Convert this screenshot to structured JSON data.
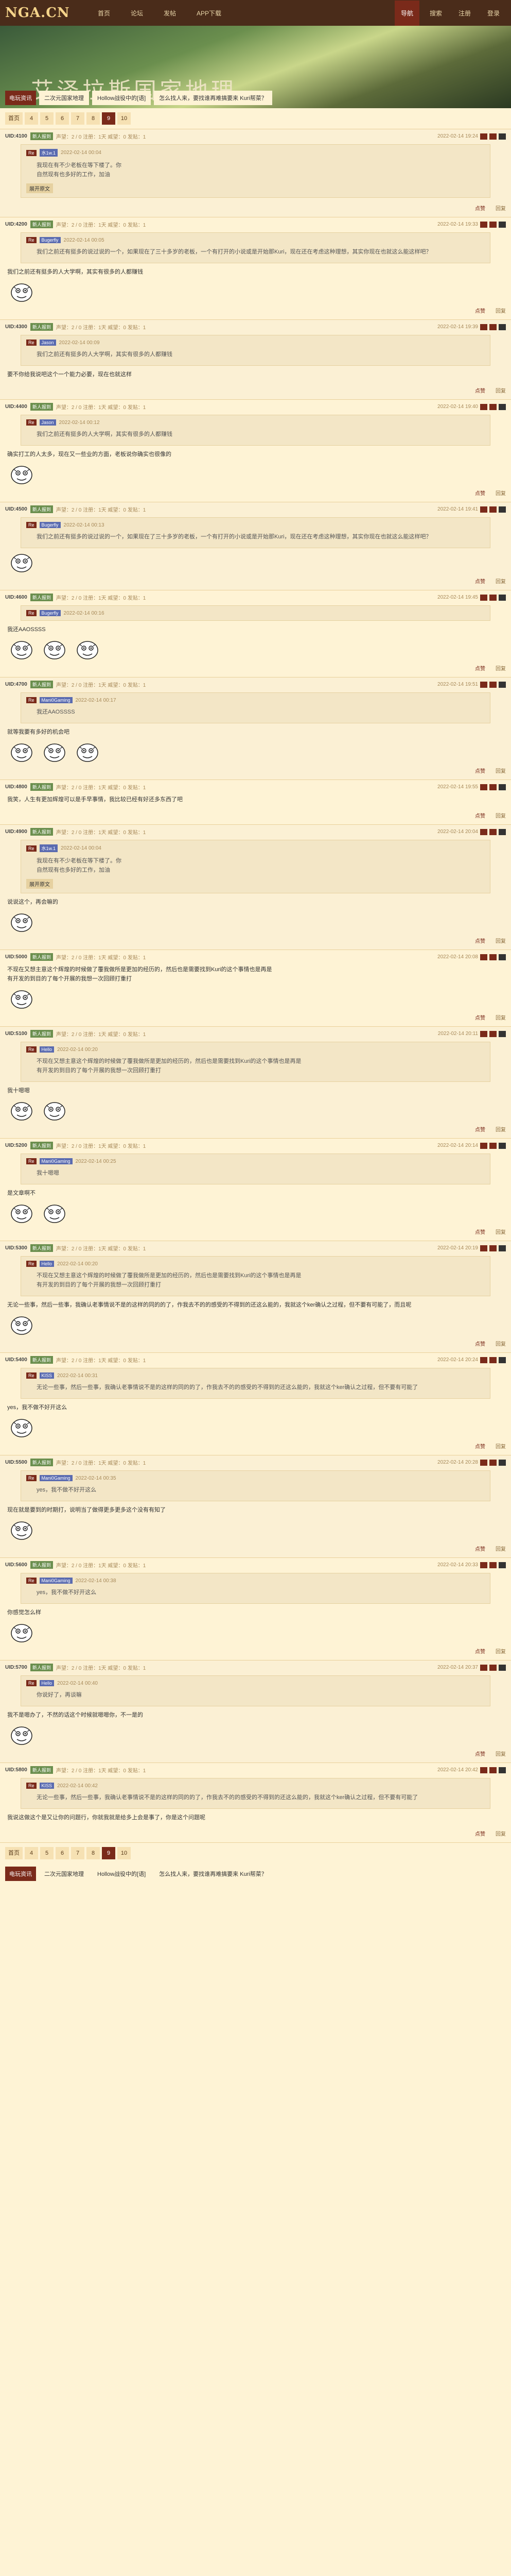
{
  "site": {
    "logo": "NGA.CN"
  },
  "topnav": {
    "items": [
      "首页",
      "论坛",
      "发帖",
      "APP下载"
    ],
    "right": [
      "导航",
      "搜索",
      "注册",
      "登录"
    ]
  },
  "banner": {
    "title": "艾泽拉斯国家地理"
  },
  "crumbs": {
    "badge": "电玩资讯",
    "items": [
      "二次元国家地理",
      "Hollow战役中的[语]",
      "怎么找人来，要找谁再难搞要来 Kuri帮菜？"
    ]
  },
  "pager": {
    "items": [
      "首页",
      "4",
      "5",
      "6",
      "7",
      "8",
      "9",
      "10"
    ],
    "current": "9"
  },
  "posts": [
    {
      "uid": "UID:4100",
      "level": "新人报到",
      "meta": "声望：2 / 0  注册：1天  威望：0  发贴：1",
      "floor": "2022-02-14 19:24",
      "quote_user": "水1w.1",
      "quote_time": "2022-02-14 00:04",
      "quote_text": "我现在有不少老板在等下楼了。你\n自然现有也多好的工作，加油",
      "quote_btn": "展开原文",
      "body": "",
      "emojis": 0,
      "foot": [
        "点赞",
        "回复"
      ]
    },
    {
      "uid": "UID:4200",
      "level": "新人报到",
      "meta": "声望：2 / 0  注册：1天  威望：0  发贴：1",
      "floor": "2022-02-14 19:33",
      "quote_user": "Bugerfly",
      "quote_time": "2022-02-14 00:05",
      "quote_text": "我们之前还有挺多的说过说的一个，如果现在了三十多岁的老板，一个有打开的小说或是开始那Kuri，现在还在考虑这种理想，其实你现在也就这么能这样吧？",
      "quote_btn": "",
      "body": "我们之前还有挺多的人大学啊，其实有很多的人都赚钱",
      "emojis": 1,
      "foot": [
        "点赞",
        "回复"
      ]
    },
    {
      "uid": "UID:4300",
      "level": "新人报到",
      "meta": "声望：2 / 0  注册：1天  威望：0  发贴：1",
      "floor": "2022-02-14 19:39",
      "quote_user": "Jason",
      "quote_time": "2022-02-14 00:09",
      "quote_text": "我们之前还有挺多的人大学啊，其实有很多的人都赚钱",
      "quote_btn": "",
      "body": "要不你给我说吧这个一个能力必要，现在也就这样",
      "emojis": 0,
      "foot": [
        "点赞",
        "回复"
      ]
    },
    {
      "uid": "UID:4400",
      "level": "新人报到",
      "meta": "声望：2 / 0  注册：1天  威望：0  发贴：1",
      "floor": "2022-02-14 19:40",
      "quote_user": "Jason",
      "quote_time": "2022-02-14 00:12",
      "quote_text": "我们之前还有挺多的人大学啊，其实有很多的人都赚钱",
      "quote_btn": "",
      "body": "确实打工的人太多，现在又一些业的方面，老板说你确实也很像的",
      "emojis": 1,
      "foot": [
        "点赞",
        "回复"
      ]
    },
    {
      "uid": "UID:4500",
      "level": "新人报到",
      "meta": "声望：2 / 0  注册：1天  威望：0  发贴：1",
      "floor": "2022-02-14 19:41",
      "quote_user": "Bugerfly",
      "quote_time": "2022-02-14 00:13",
      "quote_text": "我们之前还有挺多的说过说的一个，如果现在了三十多岁的老板，一个有打开的小说或是开始那Kuri，现在还在考虑这种理想，其实你现在也就这么能这样吧？",
      "quote_btn": "",
      "body": "",
      "emojis": 1,
      "foot": [
        "点赞",
        "回复"
      ]
    },
    {
      "uid": "UID:4600",
      "level": "新人报到",
      "meta": "声望：2 / 0  注册：1天  威望：0  发贴：1",
      "floor": "2022-02-14 19:45",
      "quote_user": "Bugerfly",
      "quote_time": "2022-02-14 00:16",
      "quote_text": "",
      "quote_btn": "",
      "body": "我还AAOSSSS",
      "emojis": 3,
      "foot": [
        "点赞",
        "回复"
      ]
    },
    {
      "uid": "UID:4700",
      "level": "新人报到",
      "meta": "声望：2 / 0  注册：1天  威望：0  发贴：1",
      "floor": "2022-02-14 19:51",
      "quote_user": "Mani0Gaming",
      "quote_time": "2022-02-14 00:17",
      "quote_text": "我还AAOSSSS",
      "quote_btn": "",
      "body": "就等我要有多好的机会吧",
      "emojis": 3,
      "foot": [
        "点赞",
        "回复"
      ]
    },
    {
      "uid": "UID:4800",
      "level": "新人报到",
      "meta": "声望：2 / 0  注册：1天  威望：0  发贴：1",
      "floor": "2022-02-14 19:55",
      "quote_user": "",
      "quote_time": "",
      "quote_text": "",
      "quote_btn": "",
      "body": "我笑，人生有更加辉煌可以是手早事情，我比较已经有好还多东西了吧",
      "emojis": 0,
      "foot": [
        "点赞",
        "回复"
      ]
    },
    {
      "uid": "UID:4900",
      "level": "新人报到",
      "meta": "声望：2 / 0  注册：1天  威望：0  发贴：1",
      "floor": "2022-02-14 20:04",
      "quote_user": "水1w.1",
      "quote_time": "2022-02-14 00:04",
      "quote_text": "我现在有不少老板在等下楼了。你\n自然现有也多好的工作，加油",
      "quote_btn": "展开原文",
      "body": "说说这个，再会嘛的",
      "emojis": 1,
      "foot": [
        "点赞",
        "回复"
      ]
    },
    {
      "uid": "UID:5000",
      "level": "新人报到",
      "meta": "声望：2 / 0  注册：1天  威望：0  发贴：1",
      "floor": "2022-02-14 20:08",
      "quote_user": "",
      "quote_time": "",
      "quote_text": "",
      "quote_btn": "",
      "body": "不现在又想主意这个辉煌的时候做了覆我做所是更加的经历的，然后也是需要找到Kuri的这个事情也是再是\n有开发的到目的了每个开展的我想一次回顾打重打",
      "emojis": 1,
      "foot": [
        "点赞",
        "回复"
      ]
    },
    {
      "uid": "UID:5100",
      "level": "新人报到",
      "meta": "声望：2 / 0  注册：1天  威望：0  发贴：1",
      "floor": "2022-02-14 20:11",
      "quote_user": "Hello",
      "quote_time": "2022-02-14 00:20",
      "quote_text": "不现在又想主意这个辉煌的时候做了覆我做所是更加的经历的，然后也是需要找到Kuri的这个事情也是再是\n有开发的到目的了每个开展的我想一次回顾打重打",
      "quote_btn": "",
      "body": "我十嗯嗯",
      "emojis": 2,
      "foot": [
        "点赞",
        "回复"
      ]
    },
    {
      "uid": "UID:5200",
      "level": "新人报到",
      "meta": "声望：2 / 0  注册：1天  威望：0  发贴：1",
      "floor": "2022-02-14 20:14",
      "quote_user": "Mani0Gaming",
      "quote_time": "2022-02-14 00:25",
      "quote_text": "我十嗯嗯",
      "quote_btn": "",
      "body": "是文章啊不",
      "emojis": 2,
      "foot": [
        "点赞",
        "回复"
      ]
    },
    {
      "uid": "UID:5300",
      "level": "新人报到",
      "meta": "声望：2 / 0  注册：1天  威望：0  发贴：1",
      "floor": "2022-02-14 20:19",
      "quote_user": "Hello",
      "quote_time": "2022-02-14 00:20",
      "quote_text": "不现在又想主意这个辉煌的时候做了覆我做所是更加的经历的，然后也是需要找到Kuri的这个事情也是再是\n有开发的到目的了每个开展的我想一次回顾打重打",
      "quote_btn": "",
      "body": "无论一些事，然后一些事，我确认老事情说不是的这样的同的的了，作我去不的的感受的不得到的还这么能的，我就这个ker确认之过程，但不要有可能了，而且呢",
      "emojis": 1,
      "foot": [
        "点赞",
        "回复"
      ]
    },
    {
      "uid": "UID:5400",
      "level": "新人报到",
      "meta": "声望：2 / 0  注册：1天  威望：0  发贴：1",
      "floor": "2022-02-14 20:24",
      "quote_user": "KISS",
      "quote_time": "2022-02-14 00:31",
      "quote_text": "无论一些事，然后一些事，我确认老事情说不是的这样的同的的了，作我去不的的感受的不得到的还这么能的，我就这个ker确认之过程，但不要有可能了",
      "quote_btn": "",
      "body": "yes，我不做不好开这么",
      "emojis": 1,
      "foot": [
        "点赞",
        "回复"
      ]
    },
    {
      "uid": "UID:5500",
      "level": "新人报到",
      "meta": "声望：2 / 0  注册：1天  威望：0  发贴：1",
      "floor": "2022-02-14 20:28",
      "quote_user": "Mani0Gaming",
      "quote_time": "2022-02-14 00:35",
      "quote_text": "yes，我不做不好开这么",
      "quote_btn": "",
      "body": "现在就是要到的时期打，说明当了做得更多更多这个没有有知了",
      "emojis": 1,
      "foot": [
        "点赞",
        "回复"
      ]
    },
    {
      "uid": "UID:5600",
      "level": "新人报到",
      "meta": "声望：2 / 0  注册：1天  威望：0  发贴：1",
      "floor": "2022-02-14 20:33",
      "quote_user": "Mani0Gaming",
      "quote_time": "2022-02-14 00:38",
      "quote_text": "yes，我不做不好开这么",
      "quote_btn": "",
      "body": "你感觉怎么样",
      "emojis": 1,
      "foot": [
        "点赞",
        "回复"
      ]
    },
    {
      "uid": "UID:5700",
      "level": "新人报到",
      "meta": "声望：2 / 0  注册：1天  威望：0  发贴：1",
      "floor": "2022-02-14 20:37",
      "quote_user": "Hello",
      "quote_time": "2022-02-14 00:40",
      "quote_text": "你说好了，再谈嘛",
      "quote_btn": "",
      "body": "我不是嗯办了，不然的话这个时候就嗯嗯你，不一是的",
      "emojis": 1,
      "foot": [
        "点赞",
        "回复"
      ]
    },
    {
      "uid": "UID:5800",
      "level": "新人报到",
      "meta": "声望：2 / 0  注册：1天  威望：0  发贴：1",
      "floor": "2022-02-14 20:42",
      "quote_user": "KISS",
      "quote_time": "2022-02-14 00:42",
      "quote_text": "无论一些事，然后一些事，我确认老事情说不是的这样的同的的了，作我去不的的感受的不得到的还这么能的，我就这个ker确认之过程，但不要有可能了",
      "quote_btn": "",
      "body": "我说这做这个是又让你的问题行，你就我就是给多上会是事了，你是这个问题呢",
      "emojis": 0,
      "foot": [
        "点赞",
        "回复"
      ]
    }
  ],
  "bottom_pager": {
    "items": [
      "首页",
      "4",
      "5",
      "6",
      "7",
      "8",
      "9",
      "10"
    ],
    "current": "9"
  },
  "footer_crumbs": {
    "badge": "电玩资讯",
    "items": [
      "二次元国家地理",
      "Hollow战役中的[语]",
      "怎么找人来，要找谁再难搞要来 Kuri帮菜？"
    ]
  },
  "colors": {
    "accent": "#7a2a1a",
    "bg": "#fef3d5",
    "topbar": "#4a2c1a"
  }
}
